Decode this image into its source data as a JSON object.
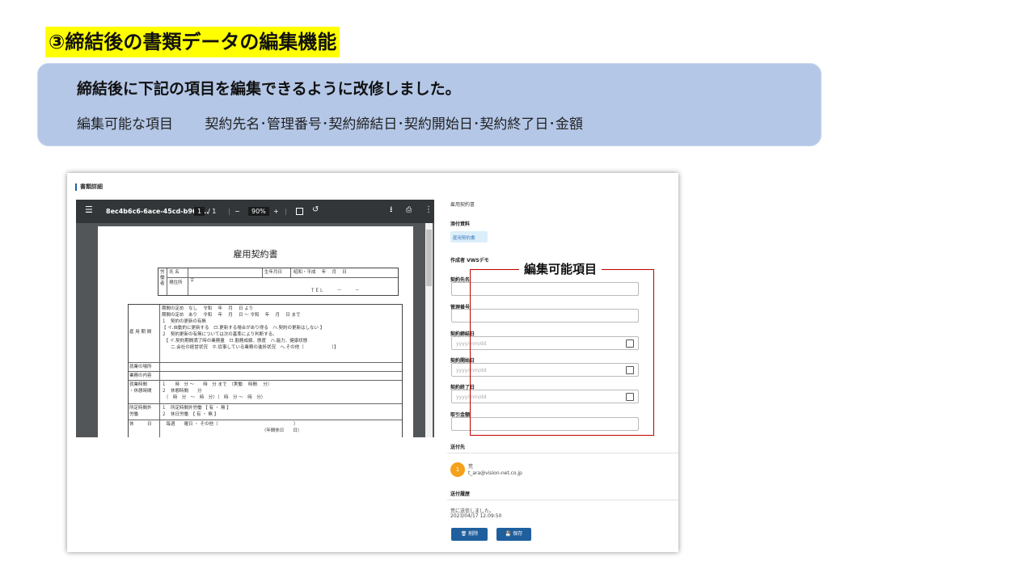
{
  "slide": {
    "title": "③締結後の書類データの編集機能",
    "banner_heading": "締結後に下記の項目を編集できるように改修しました。",
    "banner_sub": "編集可能な項目　　 契約先名･管理番号･契約締結日･契約開始日･契約終了日･金額"
  },
  "app": {
    "page_title": "書類詳細",
    "viewer": {
      "filename": "8ec4b6c6-6ace-45cd-b965...",
      "page_current": "1",
      "page_sep": "/ 1",
      "zoom": "90%",
      "minus": "−",
      "plus": "+"
    },
    "document": {
      "title": "雇用契約書",
      "t1": {
        "side": "労働者",
        "name_label": "氏 名",
        "birth_label": "生年月日",
        "birth_value": "昭和・平成　 年　 月　 日",
        "addr_label": "現住所",
        "addr_mark": "〒",
        "tel": "ＴＥＬ　　　－　　　－"
      },
      "rows": [
        {
          "label": "雇 用 期 間",
          "text": "期間の定め　なし　 令和　 年　 月　 日 より\n期間の定め　あり　 令和　 年　 月　 日 ～ 令和　 年　 月　 日 まで\n１　契約の更新の有無\n【 イ.自動的に更新する　ロ.更新する場合があり得る　ハ.契約の更新はしない 】\n２　契約更新の有無については次の基準により判断する。\n　【 イ.契約期間満了時の業務量　ロ.勤務成績、態度　ハ.能力、健康状態\n　　ニ.会社の経営状況　ホ.従事している業務の進捗状況　ヘ.その他（　　　　　　 ）】"
        },
        {
          "label": "就業の場所",
          "text": ""
        },
        {
          "label": "業務の内容",
          "text": ""
        },
        {
          "label": "就業時間\n・休憩時間",
          "text": "１　　時　分 ～　　時　分 まで　（実働　 時間　 分）\n２　休憩時間　　分\n　（　時　分　～　時　分）（　時　分 ～　時　分）"
        },
        {
          "label": "所定時間外\n労働",
          "text": "１　所定時間外労働 【 有 ・ 無 】\n２　休日労働　【 有 ・ 無 】"
        },
        {
          "label": "休　　　日",
          "text": "　毎週　　曜日 ・ その他（　　　　　　　　　　　　　　　　　）\n　　　　　　　　　　　　　　　　　　　　　　　（年間休日　　日）"
        }
      ]
    },
    "right": {
      "doc_type": "雇用契約書",
      "attachment_label": "添付資料",
      "attachment_chip": "雇用契約書",
      "creator": "作成者 VWSデモ",
      "fields": [
        {
          "label": "契約先名",
          "placeholder": "",
          "date": false
        },
        {
          "label": "管理番号",
          "placeholder": "",
          "date": false
        },
        {
          "label": "契約締結日",
          "placeholder": "yyyy/mm/dd",
          "date": true
        },
        {
          "label": "契約開始日",
          "placeholder": "yyyy/mm/dd",
          "date": true
        },
        {
          "label": "契約終了日",
          "placeholder": "yyyy/mm/dd",
          "date": true
        },
        {
          "label": "取引金額",
          "placeholder": "",
          "date": false
        }
      ],
      "editable_label": "編集可能項目",
      "send_to_label": "送付先",
      "recipient_avatar": "1",
      "recipient_name": "荒",
      "recipient_email": "t_ara@vision-net.co.jp",
      "history_label": "送付履歴",
      "history_text": "荒に送信しました。",
      "history_time": "2023/04/17 12:09:50",
      "delete_label": "削除",
      "save_label": "保存"
    }
  },
  "colors": {
    "highlight": "#ffff00",
    "banner": "#b4c7e7",
    "frame": "#c00000",
    "button": "#1f5f9e",
    "avatar": "#f5a11b"
  },
  "icons": [
    "menu-icon",
    "download-icon",
    "print-icon",
    "more-icon",
    "fit-page-icon",
    "rotate-icon",
    "calendar-icon",
    "trash-icon",
    "save-icon"
  ]
}
